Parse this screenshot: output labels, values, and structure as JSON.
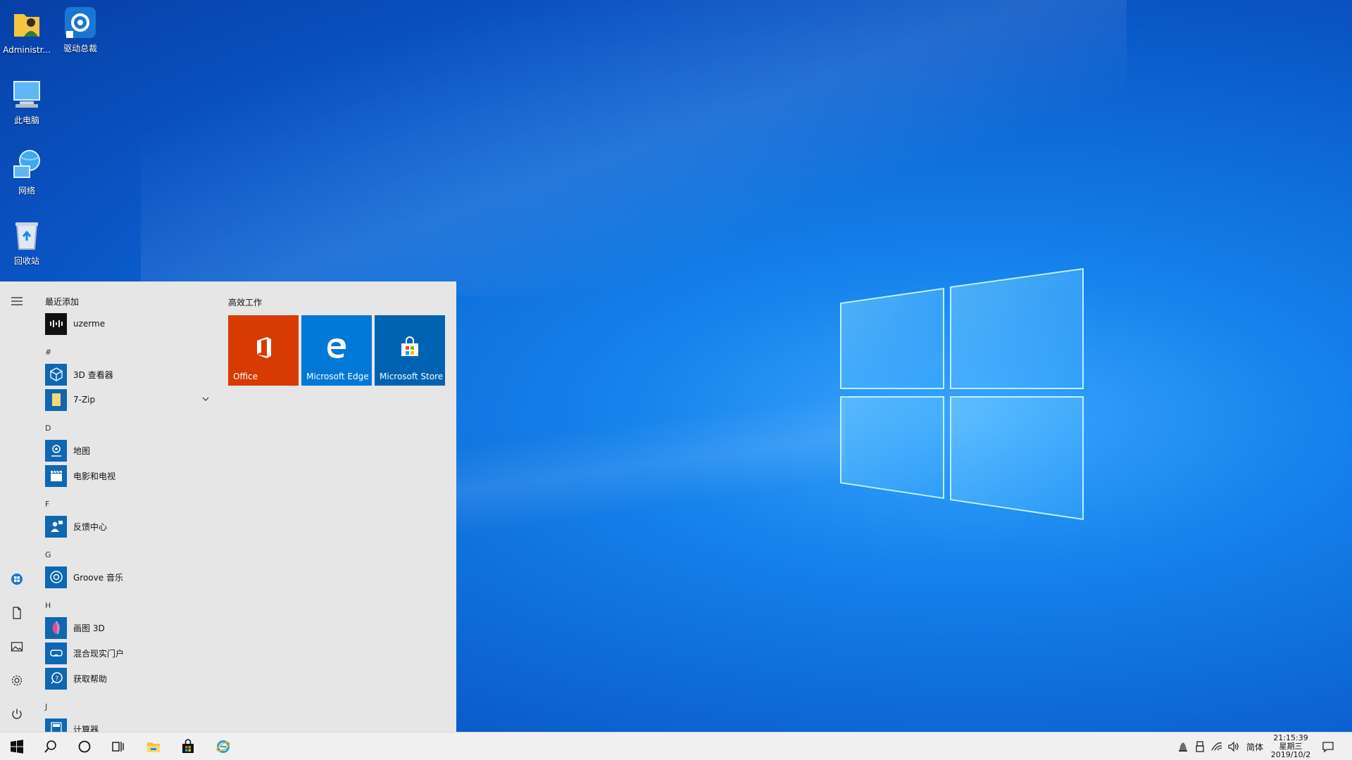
{
  "desktop": {
    "icons": [
      {
        "label": "Administr..."
      },
      {
        "label": "驱动总裁"
      },
      {
        "label": "此电脑"
      },
      {
        "label": "网络"
      },
      {
        "label": "回收站"
      }
    ]
  },
  "start_menu": {
    "recently_added_title": "最近添加",
    "recent_apps": [
      {
        "name": "uzerme"
      }
    ],
    "groups": [
      {
        "letter": "#",
        "apps": [
          {
            "name": "3D 查看器"
          },
          {
            "name": "7-Zip"
          }
        ]
      },
      {
        "letter": "D",
        "apps": [
          {
            "name": "地图"
          },
          {
            "name": "电影和电视"
          }
        ]
      },
      {
        "letter": "F",
        "apps": [
          {
            "name": "反馈中心"
          }
        ]
      },
      {
        "letter": "G",
        "apps": [
          {
            "name": "Groove 音乐"
          }
        ]
      },
      {
        "letter": "H",
        "apps": [
          {
            "name": "画图 3D"
          },
          {
            "name": "混合现实门户"
          },
          {
            "name": "获取帮助"
          }
        ]
      },
      {
        "letter": "J",
        "apps": [
          {
            "name": "计算器"
          }
        ]
      }
    ],
    "tile_group_title": "高效工作",
    "tiles": [
      {
        "label": "Office",
        "color": "#d83b01"
      },
      {
        "label": "Microsoft Edge",
        "color": "#0078d7"
      },
      {
        "label": "Microsoft Store",
        "color": "#0063b1"
      }
    ],
    "rail_icons": [
      "hamburger-icon",
      "user-account-icon",
      "documents-icon",
      "pictures-icon",
      "settings-icon",
      "power-icon"
    ]
  },
  "taskbar": {
    "icons": [
      "windows-start-icon",
      "search-icon",
      "cortana-icon",
      "task-view-icon",
      "file-explorer-icon",
      "store-icon",
      "internet-explorer-icon"
    ],
    "tray": {
      "ime": "简体",
      "time": "21:15:39",
      "weekday": "星期三",
      "date": "2019/10/2"
    }
  },
  "colors": {
    "desktop_accent": "#0f6fdb",
    "start_bg": "#e6e6e6",
    "app_icon_bg": "#0f67b1",
    "taskbar_bg": "#f0f0f0"
  }
}
